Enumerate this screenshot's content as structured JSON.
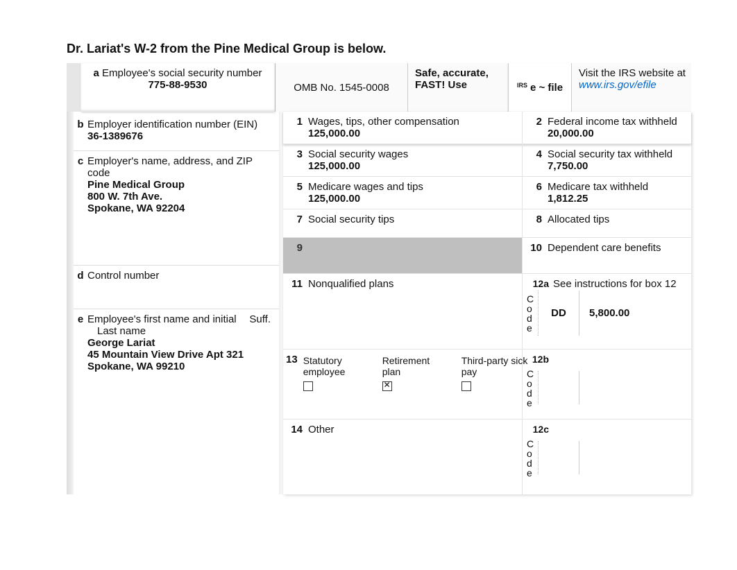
{
  "title": "Dr. Lariat's W-2 from the Pine Medical Group is below.",
  "top": {
    "a_label_prefix": "a",
    "a_label": "Employee's social security number",
    "a_value": "775-88-9530",
    "omb": "OMB No. 1545-0008",
    "safe1": "Safe, accurate,",
    "safe2": "FAST! Use",
    "irs_small": "IRS",
    "efile": "e ~ file",
    "visit": "Visit the IRS website at",
    "url": "www.irs.gov/efile"
  },
  "left": {
    "b": {
      "tag": "b",
      "label": "Employer identification number (EIN)",
      "value": "36-1389676"
    },
    "c": {
      "tag": "c",
      "label": "Employer's name, address, and ZIP code",
      "line1": "Pine Medical Group",
      "line2": "800 W. 7th Ave.",
      "line3": "Spokane, WA 92204"
    },
    "d": {
      "tag": "d",
      "label": "Control number"
    },
    "e": {
      "tag": "e",
      "label1": "Employee's first name and initial",
      "suff": "Suff.",
      "label2": "Last name",
      "line1": "George Lariat",
      "line2": "45 Mountain View Drive Apt 321",
      "line3": "Spokane, WA 99210"
    }
  },
  "boxes": {
    "b1": {
      "num": "1",
      "label": "Wages, tips, other compensation",
      "value": "125,000.00"
    },
    "b2": {
      "num": "2",
      "label": "Federal income tax withheld",
      "value": "20,000.00"
    },
    "b3": {
      "num": "3",
      "label": "Social security wages",
      "value": "125,000.00"
    },
    "b4": {
      "num": "4",
      "label": "Social security tax withheld",
      "value": "7,750.00"
    },
    "b5": {
      "num": "5",
      "label": "Medicare wages and tips",
      "value": "125,000.00"
    },
    "b6": {
      "num": "6",
      "label": "Medicare tax withheld",
      "value": "1,812.25"
    },
    "b7": {
      "num": "7",
      "label": "Social security tips"
    },
    "b8": {
      "num": "8",
      "label": "Allocated tips"
    },
    "b9": {
      "num": "9",
      "label": ""
    },
    "b10": {
      "num": "10",
      "label": "Dependent care benefits"
    },
    "b11": {
      "num": "11",
      "label": "Nonqualified plans"
    },
    "b12a": {
      "num": "12a",
      "label": "See instructions for box 12",
      "code_word": "Code",
      "code": "DD",
      "amount": "5,800.00"
    },
    "b12b": {
      "num": "12b",
      "code_word": "Code",
      "code": "",
      "amount": ""
    },
    "b12c": {
      "num": "12c",
      "code_word": "Code",
      "code": "",
      "amount": ""
    },
    "b13": {
      "num": "13",
      "opt1": "Statutory employee",
      "opt2": "Retirement plan",
      "opt3": "Third-party sick pay"
    },
    "b14": {
      "num": "14",
      "label": "Other"
    }
  }
}
